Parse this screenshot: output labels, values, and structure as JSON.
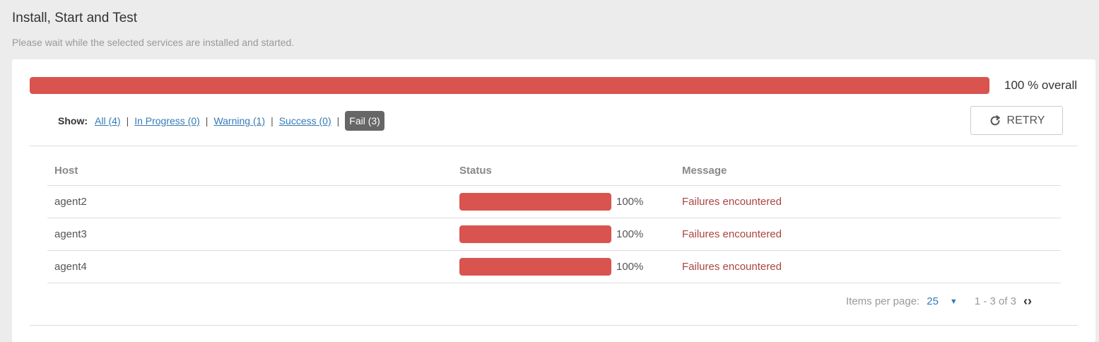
{
  "header": {
    "title": "Install, Start and Test",
    "subtitle": "Please wait while the selected services are installed and started."
  },
  "overall": {
    "progress_fraction": 1.0,
    "label": "100 % overall",
    "bar_color": "#d9534f"
  },
  "filters": {
    "show_label": "Show:",
    "items": [
      {
        "label": "All (4)"
      },
      {
        "label": "In Progress (0)"
      },
      {
        "label": "Warning (1)"
      },
      {
        "label": "Success (0)"
      },
      {
        "label": "Fail (3)",
        "active": true
      }
    ]
  },
  "retry": {
    "label": "RETRY",
    "icon": "refresh-icon"
  },
  "table": {
    "columns": [
      "Host",
      "Status",
      "Message"
    ],
    "rows": [
      {
        "host": "agent2",
        "progress_fraction": 1.0,
        "percent": "100%",
        "message": "Failures encountered"
      },
      {
        "host": "agent3",
        "progress_fraction": 1.0,
        "percent": "100%",
        "message": "Failures encountered"
      },
      {
        "host": "agent4",
        "progress_fraction": 1.0,
        "percent": "100%",
        "message": "Failures encountered"
      }
    ]
  },
  "pagination": {
    "items_per_page_label": "Items per page:",
    "items_per_page_value": "25",
    "range": "1 - 3 of 3"
  },
  "colors": {
    "fail": "#d9534f",
    "fail_text": "#a94442",
    "link": "#337ab7",
    "active_filter_bg": "#666666"
  }
}
